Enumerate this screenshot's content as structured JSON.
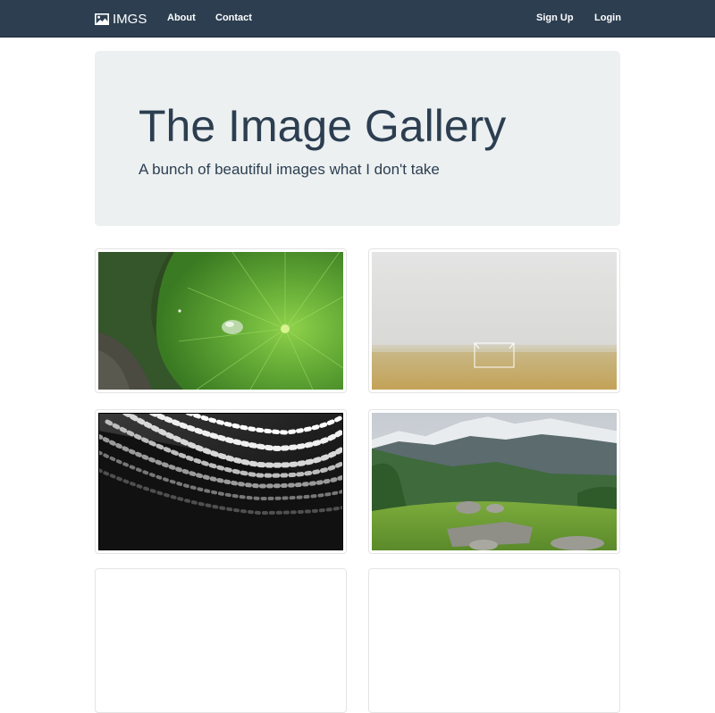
{
  "navbar": {
    "brand": {
      "label": "IMGS",
      "icon": "picture-icon"
    },
    "links": [
      {
        "label": "About"
      },
      {
        "label": "Contact"
      }
    ],
    "right_links": [
      {
        "label": "Sign Up"
      },
      {
        "label": "Login"
      }
    ]
  },
  "jumbotron": {
    "title": "The Image Gallery",
    "subtitle": "A bunch of beautiful images what I don't take"
  },
  "gallery": {
    "images": [
      {
        "name": "lotus-leaf-water-drop"
      },
      {
        "name": "foggy-field-goal"
      },
      {
        "name": "curved-architecture-bw"
      },
      {
        "name": "mountain-meadow-rocks"
      },
      {
        "name": "partial-image-5"
      },
      {
        "name": "partial-image-6"
      }
    ]
  },
  "colors": {
    "navbar": "#2c3e50",
    "jumbotron": "#ecf0f1",
    "text": "#2c3e50"
  }
}
